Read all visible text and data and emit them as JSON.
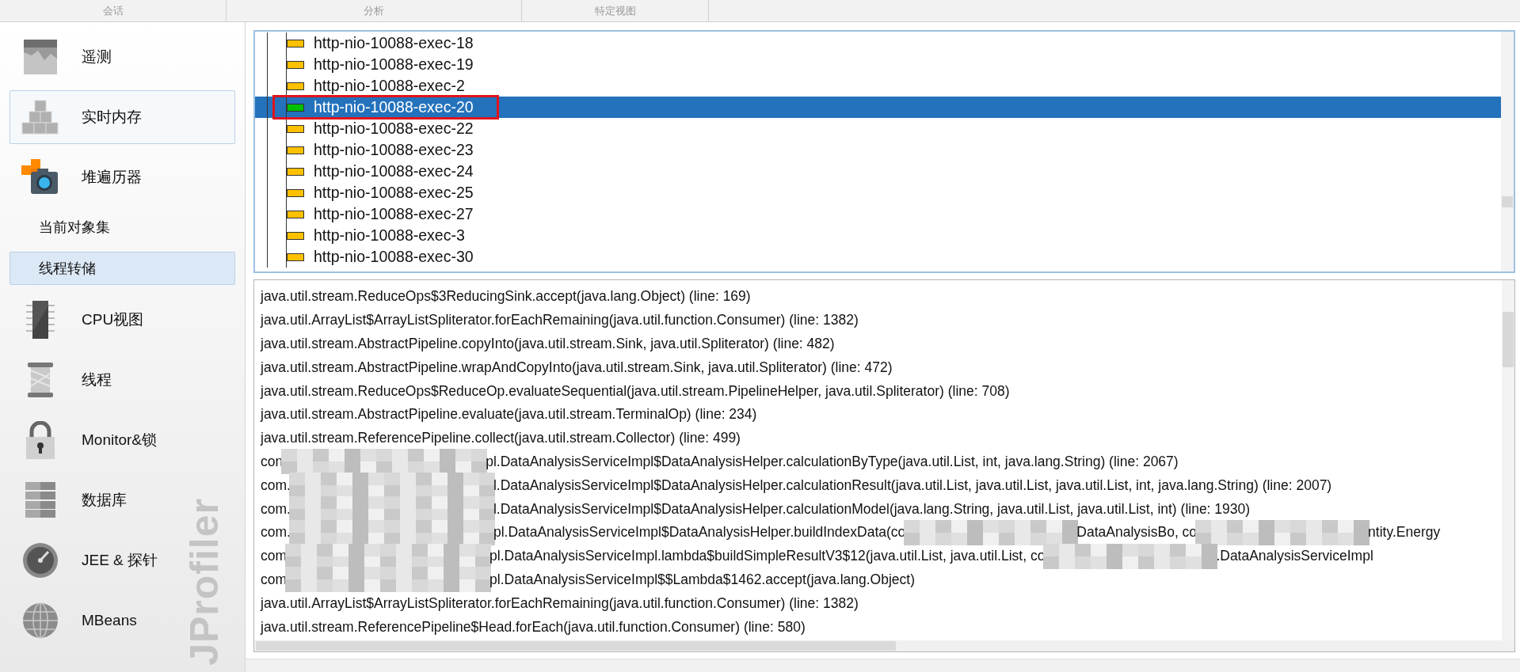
{
  "tabs": [
    {
      "label": "会话"
    },
    {
      "label": "分析"
    },
    {
      "label": "特定视图"
    }
  ],
  "sidebar": {
    "logo": "JProfiler",
    "items": [
      {
        "label": "遥测",
        "kind": "telemetry",
        "selected": false,
        "hovered": false
      },
      {
        "label": "实时内存",
        "kind": "memory",
        "selected": false,
        "hovered": true
      },
      {
        "label": "堆遍历器",
        "kind": "heap",
        "selected": false,
        "hovered": false,
        "children": [
          {
            "label": "当前对象集",
            "selected": false
          },
          {
            "label": "线程转储",
            "selected": true
          }
        ]
      },
      {
        "label": "CPU视图",
        "kind": "cpu",
        "selected": false,
        "hovered": false
      },
      {
        "label": "线程",
        "kind": "threads",
        "selected": false,
        "hovered": false
      },
      {
        "label": "Monitor&锁",
        "kind": "lock",
        "selected": false,
        "hovered": false
      },
      {
        "label": "数据库",
        "kind": "database",
        "selected": false,
        "hovered": false
      },
      {
        "label": "JEE & 探针",
        "kind": "probe",
        "selected": false,
        "hovered": false
      },
      {
        "label": "MBeans",
        "kind": "globe",
        "selected": false,
        "hovered": false
      }
    ]
  },
  "threads": {
    "rows": [
      {
        "name": "http-nio-10088-exec-18",
        "color": "#ffc000",
        "selected": false,
        "annotated": false
      },
      {
        "name": "http-nio-10088-exec-19",
        "color": "#ffc000",
        "selected": false,
        "annotated": false
      },
      {
        "name": "http-nio-10088-exec-2",
        "color": "#ffc000",
        "selected": false,
        "annotated": false
      },
      {
        "name": "http-nio-10088-exec-20",
        "color": "#00c000",
        "selected": true,
        "annotated": true
      },
      {
        "name": "http-nio-10088-exec-22",
        "color": "#ffc000",
        "selected": false,
        "annotated": false
      },
      {
        "name": "http-nio-10088-exec-23",
        "color": "#ffc000",
        "selected": false,
        "annotated": false
      },
      {
        "name": "http-nio-10088-exec-24",
        "color": "#ffc000",
        "selected": false,
        "annotated": false
      },
      {
        "name": "http-nio-10088-exec-25",
        "color": "#ffc000",
        "selected": false,
        "annotated": false
      },
      {
        "name": "http-nio-10088-exec-27",
        "color": "#ffc000",
        "selected": false,
        "annotated": false
      },
      {
        "name": "http-nio-10088-exec-3",
        "color": "#ffc000",
        "selected": false,
        "annotated": false
      },
      {
        "name": "http-nio-10088-exec-30",
        "color": "#ffc000",
        "selected": false,
        "annotated": false
      }
    ]
  },
  "stack": {
    "lines": [
      {
        "segments": [
          {
            "kind": "text",
            "text": "java.util.stream.ReduceOps$3ReducingSink.accept(java.lang.Object) (line: 169)"
          }
        ]
      },
      {
        "segments": [
          {
            "kind": "text",
            "text": "java.util.ArrayList$ArrayListSpliterator.forEachRemaining(java.util.function.Consumer) (line: 1382)"
          }
        ]
      },
      {
        "segments": [
          {
            "kind": "text",
            "text": "java.util.stream.AbstractPipeline.copyInto(java.util.stream.Sink, java.util.Spliterator) (line: 482)"
          }
        ]
      },
      {
        "segments": [
          {
            "kind": "text",
            "text": "java.util.stream.AbstractPipeline.wrapAndCopyInto(java.util.stream.Sink, java.util.Spliterator) (line: 472)"
          }
        ]
      },
      {
        "segments": [
          {
            "kind": "text",
            "text": "java.util.stream.ReduceOps$ReduceOp.evaluateSequential(java.util.stream.PipelineHelper, java.util.Spliterator) (line: 708)"
          }
        ]
      },
      {
        "segments": [
          {
            "kind": "text",
            "text": "java.util.stream.AbstractPipeline.evaluate(java.util.stream.TerminalOp) (line: 234)"
          }
        ]
      },
      {
        "segments": [
          {
            "kind": "text",
            "text": "java.util.stream.ReferencePipeline.collect(java.util.stream.Collector) (line: 499)"
          }
        ]
      },
      {
        "segments": [
          {
            "kind": "text",
            "text": "con"
          },
          {
            "kind": "redacted"
          },
          {
            "kind": "text",
            "text": "pl.DataAnalysisServiceImpl$DataAnalysisHelper.calculationByType(java.util.List, int, java.lang.String) (line: 2067)"
          }
        ]
      },
      {
        "segments": [
          {
            "kind": "text",
            "text": "com."
          },
          {
            "kind": "redacted"
          },
          {
            "kind": "text",
            "text": "l.DataAnalysisServiceImpl$DataAnalysisHelper.calculationResult(java.util.List, java.util.List, java.util.List, int, java.lang.String) (line: 2007)"
          }
        ]
      },
      {
        "segments": [
          {
            "kind": "text",
            "text": "com."
          },
          {
            "kind": "redacted"
          },
          {
            "kind": "text",
            "text": "l.DataAnalysisServiceImpl$DataAnalysisHelper.calculationModel(java.lang.String, java.util.List, java.util.List, int) (line: 1930)"
          }
        ]
      },
      {
        "segments": [
          {
            "kind": "text",
            "text": "com."
          },
          {
            "kind": "redacted"
          },
          {
            "kind": "text",
            "text": "pl.DataAnalysisServiceImpl$DataAnalysisHelper.buildIndexData(co"
          },
          {
            "kind": "redacted"
          },
          {
            "kind": "text",
            "text": "DataAnalysisBo, co"
          },
          {
            "kind": "redacted"
          },
          {
            "kind": "text",
            "text": "ntity.Energy"
          }
        ]
      },
      {
        "segments": [
          {
            "kind": "text",
            "text": "com"
          },
          {
            "kind": "redacted"
          },
          {
            "kind": "text",
            "text": "pl.DataAnalysisServiceImpl.lambda$buildSimpleResultV3$12(java.util.List, java.util.List, co"
          },
          {
            "kind": "redacted"
          },
          {
            "kind": "text",
            "text": ".DataAnalysisServiceImpl"
          }
        ]
      },
      {
        "segments": [
          {
            "kind": "text",
            "text": "com"
          },
          {
            "kind": "redacted"
          },
          {
            "kind": "text",
            "text": "pl.DataAnalysisServiceImpl$$Lambda$1462.accept(java.lang.Object)"
          }
        ]
      },
      {
        "segments": [
          {
            "kind": "text",
            "text": "java.util.ArrayList$ArrayListSpliterator.forEachRemaining(java.util.function.Consumer) (line: 1382)"
          }
        ]
      },
      {
        "segments": [
          {
            "kind": "text",
            "text": "java.util.stream.ReferencePipeline$Head.forEach(java.util.function.Consumer) (line: 580)"
          }
        ]
      }
    ]
  }
}
